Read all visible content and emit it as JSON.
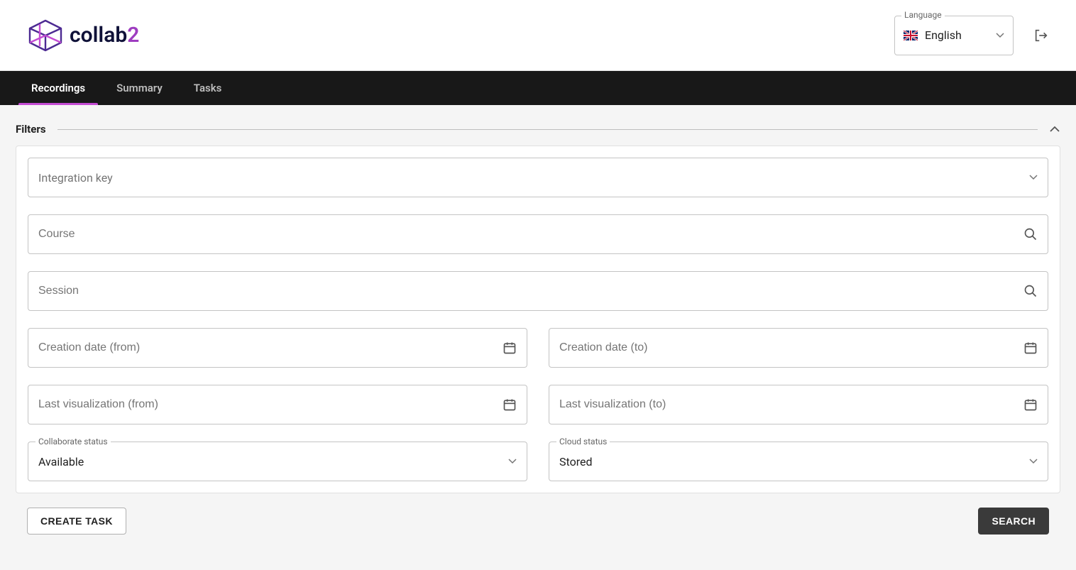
{
  "header": {
    "logo_text_1": "collab",
    "logo_text_2": "2",
    "language_label": "Language",
    "language_value": "English"
  },
  "nav": {
    "tabs": [
      {
        "label": "Recordings",
        "active": true
      },
      {
        "label": "Summary",
        "active": false
      },
      {
        "label": "Tasks",
        "active": false
      }
    ]
  },
  "filters": {
    "title": "Filters",
    "integration_key_placeholder": "Integration key",
    "course_placeholder": "Course",
    "session_placeholder": "Session",
    "creation_from_placeholder": "Creation date (from)",
    "creation_to_placeholder": "Creation date (to)",
    "last_viz_from_placeholder": "Last visualization (from)",
    "last_viz_to_placeholder": "Last visualization (to)",
    "collab_status_label": "Collaborate status",
    "collab_status_value": "Available",
    "cloud_status_label": "Cloud status",
    "cloud_status_value": "Stored"
  },
  "actions": {
    "create_task": "Create task",
    "search": "Search"
  }
}
